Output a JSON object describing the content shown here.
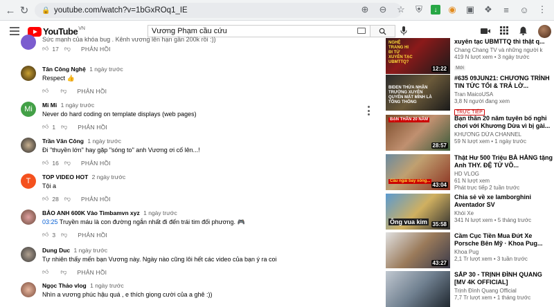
{
  "browser": {
    "url": "youtube.com/watch?v=1bGxROq1_IE"
  },
  "header": {
    "logo_text": "YouTube",
    "logo_country": "VN",
    "search_value": "Vương Phạm cầu cứu"
  },
  "comments": [
    {
      "author": "",
      "time": "",
      "text": "Sức mạnh của khóa bug . Kênh vương lên hạn gần 200k rồi :))",
      "likes": "17",
      "reply": "PHẢN HỒI"
    },
    {
      "author": "Tân Công Nghệ",
      "time": "1 ngày trước",
      "text": "Respect 👍",
      "likes": "",
      "reply": "PHẢN HỒI"
    },
    {
      "author": "Mi Mi",
      "time": "1 ngày trước",
      "text": "Never do hard coding on template displays (web pages)",
      "likes": "1",
      "reply": "PHẢN HỒI",
      "avatar_letter": "Mi"
    },
    {
      "author": "Trần Văn Công",
      "time": "1 ngày trước",
      "text": "Đi \"thuyền lớn\" hay gặp \"sóng to\" anh Vương ơi cố lên...!",
      "likes": "16",
      "reply": "PHẢN HỒI"
    },
    {
      "author": "TOP VIDEO HOT",
      "time": "2 ngày trước",
      "text": "Tội a",
      "likes": "28",
      "reply": "PHẢN HỒI",
      "avatar_letter": "T"
    },
    {
      "author": "BẢO ANH 600K Vào Timbamvn xyz",
      "time": "1 ngày trước",
      "time_link": "03:25",
      "text": "Truyền máu là con đường ngắn nhất đi đến trái tim đối phương. 🎮",
      "likes": "3",
      "reply": "PHẢN HỒI"
    },
    {
      "author": "Dung Duc",
      "time": "1 ngày trước",
      "text": "Tự nhiên thấy mến bạn Vương này. Ngày nào cũng lôi hết các video của bạn ý ra coi",
      "likes": "",
      "reply": "PHẢN HỒI"
    },
    {
      "author": "Ngọc Thảo vlog",
      "time": "1 ngày trước",
      "text": "Nhìn a vương phúc hậu quá , e thích giọng cười của a ghê :))",
      "likes": "",
      "reply": "PHẢN HỒI"
    }
  ],
  "videos": [
    {
      "title": "xuyên tạc UBMTTQ thì thật q...",
      "channel": "Chang Chang TV và những người k",
      "meta": "419 N lượt xem • 3 ngày trước",
      "badge": "Mới",
      "duration": "12:22",
      "thumb_text": "NGHỆ TRANG HI ĐI TỪ XUYÊN TẠC UBMTTQ?"
    },
    {
      "title": "#635 09JUN21: CHƯƠNG TRÌNH TIN TỨC TỐI & TRẢ LỜ...",
      "channel": "Tran MaicoUSA",
      "meta": "3,8 N người đang xem",
      "badge": "TRỰC TIẾP",
      "duration": "",
      "thumb_text": "BIDEN THỪA NHẬN TRƯỜNG XUYÊN QUYẾN MẤT MÌNH LÀ TỔNG THỐNG"
    },
    {
      "title": "Bạn thân 20 năm tuyên bố nghỉ chơi với Khương Dừa vì bị gài...",
      "channel": "KHƯƠNG DỪA CHANNEL",
      "meta": "59 N lượt xem • 1 ngày trước",
      "badge": "",
      "duration": "28:57",
      "thumb_text": "BẠN THÂN 20 NĂM"
    },
    {
      "title": "Thật Hư 500 Triệu BÀ HẰNG tặng Anh THY. ĐỆ TỬ VÕ...",
      "channel": "HD VLOG",
      "meta": "61 N lượt xem",
      "meta2": "Phát trực tiếp 2 tuần trước",
      "badge": "",
      "duration": "43:04",
      "thumb_text": "Cầu ngái bay xóng..."
    },
    {
      "title": "Chia sẻ về xe lamborghini Aventador SV",
      "channel": "Khói Xe",
      "meta": "341 N lượt xem • 5 tháng trước",
      "badge": "",
      "duration": "35:58",
      "thumb_text": "Ông vua kim"
    },
    {
      "title": "Cầm Cục Tiền Mua Đứt Xe Porsche Bên Mỹ · Khoa Pug...",
      "channel": "Khoa Pug",
      "meta": "2,1 Tr lượt xem • 3 tuần trước",
      "badge": "",
      "duration": "43:27",
      "thumb_text": ""
    },
    {
      "title": "SẮP 30 - TRỊNH ĐÌNH QUANG [MV 4K OFFICIAL]",
      "channel": "Trịnh Đình Quang Official",
      "meta": "7,7 Tr lượt xem • 1 tháng trước",
      "badge": "",
      "duration": "",
      "thumb_text": ""
    }
  ]
}
